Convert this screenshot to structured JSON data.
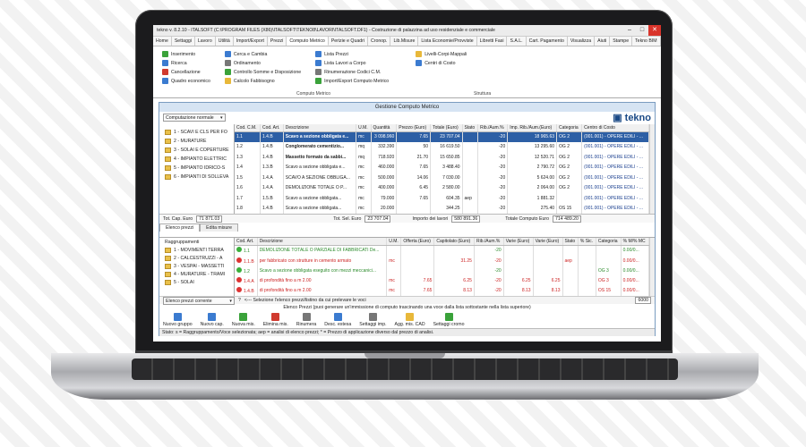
{
  "window": {
    "title": "tekno v. 8.2.10 - ITALSOFT (C:\\PROGRAM FILES (X86)\\ITALSOFT\\TEKNO8\\LAVORI\\ITALSOFT.DF1) - Costruzione di palazzina ad uso residenziale e commerciale"
  },
  "menu": [
    "Home",
    "Settaggi",
    "Lavoro",
    "Utilità",
    "Import/Export",
    "Prezzi",
    "Computo Metrico",
    "Perizie e Quadri",
    "Cronop.",
    "Lib.Misure",
    "Lista Economie/Provviste",
    "Libretti Fasi",
    "S.A.L.",
    "Cart. Pagamento",
    "Visualizza",
    "Aiuti",
    "Stampe",
    "Tekno BIM"
  ],
  "ribbon": {
    "col1": [
      "Inserimento",
      "Ricerca",
      "Cancellazione",
      "Quadro economico"
    ],
    "col2": [
      "Cerca e Cambia",
      "Ordinamento",
      "Controllo Somme e Disposizione",
      "Calcolo Fabbisogno"
    ],
    "col3": [
      "Lista Prezzi",
      "Lista Lavori a Corpo",
      "Rinumerazione Codici C.M.",
      "Import/Export Computo Metrico"
    ],
    "col4": [
      "Livelli-Corpi-Mappali",
      "Centri di Costo"
    ],
    "group1": "Computo Metrico",
    "group2": "Struttura"
  },
  "sub": {
    "title": "Gestione Computo Metrico",
    "mode": "Computazione normale",
    "logo": "tekno",
    "tree": [
      "1 - SCAVI E CLS PER FO",
      "2 - MURATURE",
      "3 - SOLAI E COPERTURE",
      "4 - IMPIANTO ELETTRIC",
      "5 - IMPIANTO IDRICO-S",
      "6 - IMPIANTI DI SOLLEVA"
    ],
    "headers": [
      "Cod. C.M.",
      "Cod. Art.",
      "Descrizione",
      "U.M.",
      "Quantità",
      "Prezzo (Euro)",
      "Totale (Euro)",
      "Stato",
      "Rib./Aum.%",
      "Imp. Rib./Aum.(Euro)",
      "Categoria",
      "Centro di Costo"
    ],
    "rows": [
      [
        "1.1",
        "1.4.B",
        "Scavo a sezione obbligata e...",
        "mc",
        "3 098.960",
        "7.65",
        "23 707.04",
        "",
        "-20",
        "18 965.63",
        "OG 2",
        "(001.001) - OPERE EDILI - ..."
      ],
      [
        "1.2",
        "1.4.B",
        "Conglomerato cementizio...",
        "mq",
        "332.390",
        "50",
        "16 619.50",
        "",
        "-20",
        "13 295.60",
        "OG 2",
        "(001.001) - OPERE EDILI - ..."
      ],
      [
        "1.3",
        "1.4.B",
        "Massetto formato da sabbi...",
        "mq",
        "718.920",
        "21.70",
        "15 650.85",
        "",
        "-20",
        "12 520.71",
        "OG 2",
        "(001.001) - OPERE EDILI - ..."
      ],
      [
        "1.4",
        "1.3.B",
        "Scavo a sezione obbligata e...",
        "mc",
        "460.000",
        "7.65",
        "3 488.40",
        "",
        "-20",
        "2 790.72",
        "OG 2",
        "(001.001) - OPERE EDILI - ..."
      ],
      [
        "1.5",
        "1.4.A",
        "SCAVO A SEZIONE OBBLIGA...",
        "mc",
        "500.000",
        "14.06",
        "7 030.00",
        "",
        "-20",
        "5 624.00",
        "OG 2",
        "(001.001) - OPERE EDILI - ..."
      ],
      [
        "1.6",
        "1.4.A",
        "DEMOLIZIONE TOTALE O P...",
        "mc",
        "400.000",
        "6.45",
        "2 580.00",
        "",
        "-20",
        "2 064.00",
        "OG 2",
        "(001.001) - OPERE EDILI - ..."
      ],
      [
        "1.7",
        "1.5.B",
        "Scavo a sezione obbligata...",
        "mc",
        "79.000",
        "7.65",
        "604.35",
        "aep",
        "-20",
        "1 881.32",
        "",
        "(001.001) - OPERE EDILI - ..."
      ],
      [
        "1.8",
        "1.4.B",
        "Scavo a sezione obbligata...",
        "mc",
        "20.000",
        "",
        "344.25",
        "",
        "-20",
        "275.40",
        "OS 15",
        "(001.001) - OPERE EDILI - ..."
      ]
    ],
    "totals": {
      "cap_label": "Tot. Cap. Euro",
      "cap_value": "71 871.03",
      "sel_label": "Tot. Sel. Euro",
      "sel_value": "23 707.04",
      "lav_label": "Importo dei lavori",
      "lav_value": "580 891.36",
      "comp_label": "Totale Computo Euro",
      "comp_value": "714 489.20"
    },
    "tabs": [
      "Elenco prezzi",
      "Edita misure"
    ],
    "tree2_header": "Raggruppamenti",
    "tree2": [
      "1 - MOVIMENTI TERRA",
      "2 - CALCESTRUZZI - A",
      "3 - VESPAI - MASSETTI",
      "4 - MURATURE - TRAMI",
      "5 - SOLAI"
    ],
    "tree2_combo": "Elenco prezzi corrente",
    "headers2": [
      "Cod. Art.",
      "Descrizione",
      "U.M.",
      "Offerta (Euro)",
      "Capitolato (Euro)",
      "Rib./Aum.%",
      "Varie (Euro)",
      "Varie (Euro)",
      "Stato",
      "% Sic.",
      "Categoria",
      "% M/% MC"
    ],
    "rows2": [
      [
        "1.1",
        "DEMOLIZIONE TOTALE O PARZIALE DI FABBRICATI De...",
        "",
        "",
        "",
        "-20",
        "",
        "",
        "",
        "",
        "",
        "0.00/0..."
      ],
      [
        "1.1.B",
        "per fabbricato con strutture in cemento armato",
        "mc",
        "",
        "31.25",
        "-20",
        "",
        "",
        "aep",
        "",
        "",
        "0.00/0..."
      ],
      [
        "1.2",
        "Scavo a sezione obbligata eseguito con mezzi meccanici...",
        "",
        "",
        "",
        "-20",
        "",
        "",
        "",
        "",
        "OG 3",
        "0.00/0..."
      ],
      [
        "1.4.A",
        "di profondità fino a m 2.00",
        "mc",
        "7.65",
        "6.25",
        "-20",
        "6.25",
        "6.25",
        "",
        "",
        "OG 3",
        "0.00/0..."
      ],
      [
        "1.4.B",
        "di profondità fino a m 2.00",
        "mc",
        "7.65",
        "8.13",
        "-20",
        "8.13",
        "8.13",
        "",
        "",
        "OS 15",
        "0.00/0..."
      ]
    ],
    "sel_hint": "<--- Selezione l'elenco prezzi/listino da cui prelevare le voci",
    "sel_value": "6000",
    "hint": "Elenco Prezzi (puoi generare un'immissione di computo trascinando una voce dalla lista sottostante nella lista superiore)",
    "buttons": [
      "Nuovo gruppo",
      "Nuovo cap.",
      "Nuova mis.",
      "Elimina mis.",
      "Rinumera",
      "Desc. estesa",
      "Settaggi imp.",
      "Agg. mis. CAD",
      "Settaggi cromo"
    ],
    "status": "Stato: s = Raggruppamento/Voce selezionata; aep = analisi di elenco prezzi; * = Prezzo di applicazione diverso dal prezzo di analisi."
  }
}
